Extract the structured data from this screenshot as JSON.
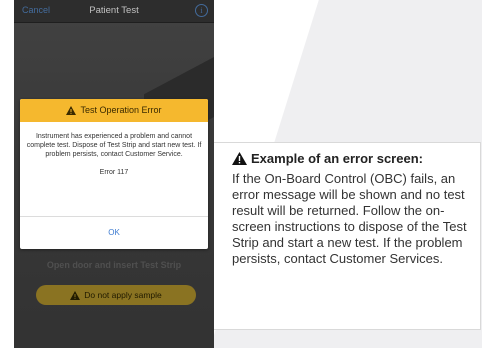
{
  "topbar": {
    "cancel_label": "Cancel",
    "title": "Patient Test",
    "info_icon": "info-icon"
  },
  "dialog": {
    "title": "Test Operation Error",
    "message": "Instrument has experienced a problem and cannot complete test. Dispose of Test Strip and start new test. If problem persists, contact Customer Service.",
    "error_code": "Error 117",
    "ok_label": "OK"
  },
  "background": {
    "instruction": "Open door and insert Test Strip",
    "warning_label": "Do not apply sample"
  },
  "callout": {
    "heading": "Example of an error screen:",
    "body": "If the On-Board Control (OBC) fails, an error message will be shown and no test result will be returned. Follow the on-screen instructions to dispose of the Test Strip and start a new test. If the problem persists, contact Customer Services."
  },
  "colors": {
    "dialog_header": "#f5b82e",
    "link_blue": "#3d7bd0",
    "sample_pill": "#b99a2e"
  }
}
